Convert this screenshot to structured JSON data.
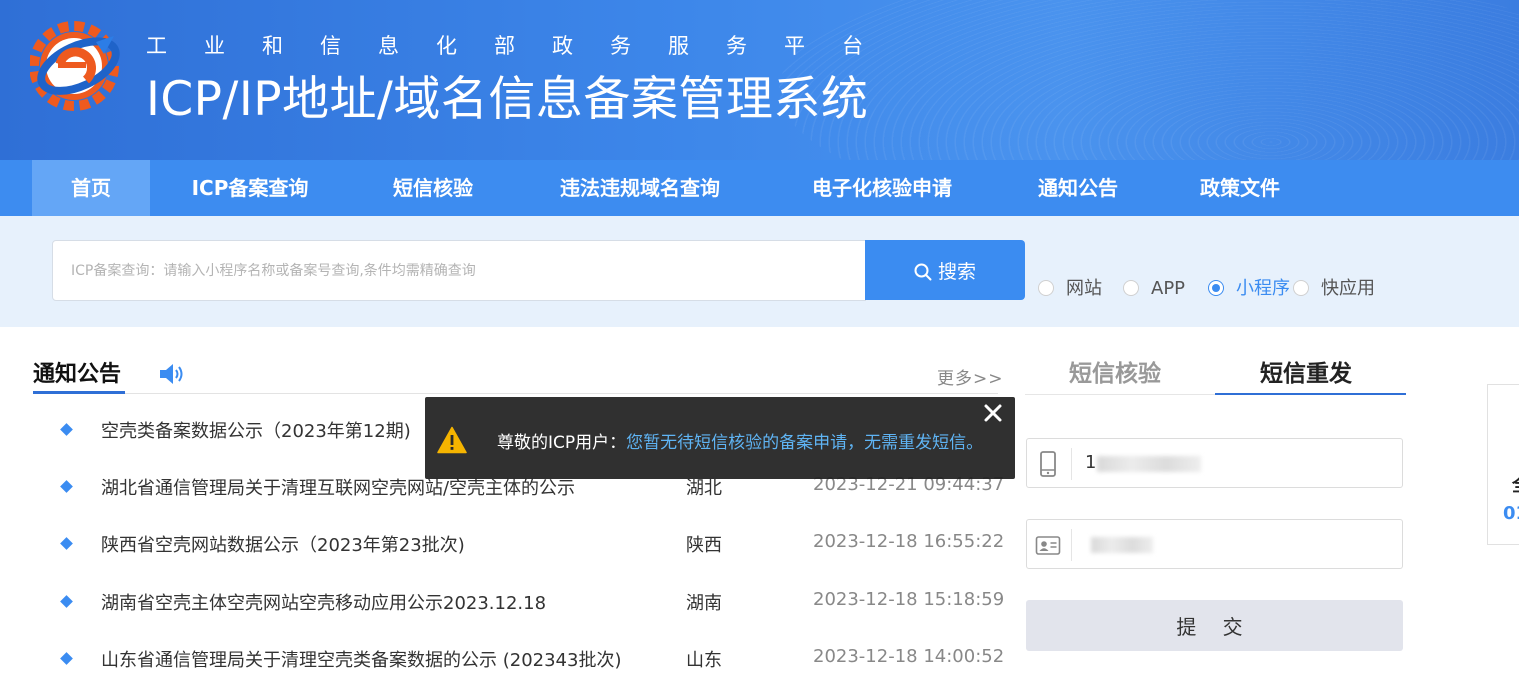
{
  "header": {
    "subtitle": "工业和信息化部政务服务平台",
    "title": "ICP/IP地址/域名信息备案管理系统"
  },
  "nav": {
    "items": [
      {
        "label": "首页",
        "active": true
      },
      {
        "label": "ICP备案查询",
        "active": false
      },
      {
        "label": "短信核验",
        "active": false
      },
      {
        "label": "违法违规域名查询",
        "active": false
      },
      {
        "label": "电子化核验申请",
        "active": false
      },
      {
        "label": "通知公告",
        "active": false
      },
      {
        "label": "政策文件",
        "active": false
      }
    ]
  },
  "search": {
    "placeholder": "ICP备案查询：请输入小程序名称或备案号查询,条件均需精确查询",
    "value": "",
    "button_label": "搜索",
    "options": [
      {
        "label": "网站",
        "checked": false
      },
      {
        "label": "APP",
        "checked": false
      },
      {
        "label": "小程序",
        "checked": true
      },
      {
        "label": "快应用",
        "checked": false
      }
    ]
  },
  "notices": {
    "heading": "通知公告",
    "more_label": "更多>>",
    "rows": [
      {
        "title": "空壳类备案数据公示（2023年第12期)",
        "province": "",
        "date": ""
      },
      {
        "title": "湖北省通信管理局关于清理互联网空壳网站/空壳主体的公示",
        "province": "湖北",
        "date": "2023-12-21 09:44:37"
      },
      {
        "title": "陕西省空壳网站数据公示（2023年第23批次)",
        "province": "陕西",
        "date": "2023-12-18 16:55:22"
      },
      {
        "title": "湖南省空壳主体空壳网站空壳移动应用公示2023.12.18",
        "province": "湖南",
        "date": "2023-12-18 15:18:59"
      },
      {
        "title": "山东省通信管理局关于清理空壳类备案数据的公示 (202343批次)",
        "province": "山东",
        "date": "2023-12-18 14:00:52"
      }
    ]
  },
  "sms_panel": {
    "tabs": [
      {
        "label": "短信核验",
        "active": false
      },
      {
        "label": "短信重发",
        "active": true
      }
    ],
    "phone_value": "1",
    "id_value": "",
    "submit_label": "提 交"
  },
  "side_card": {
    "line1": "全",
    "line2": "01"
  },
  "toast": {
    "prefix": "尊敬的ICP用户：",
    "message": "您暂无待短信核验的备案申请，无需重发短信。"
  },
  "colors": {
    "primary": "#3b8cf1",
    "nav_bg": "#3d8cf0",
    "nav_active": "#64a6f6",
    "search_band": "#e7f1fc",
    "toast_link": "#5fb4f4",
    "warning": "#f5b400",
    "logo_orange": "#ee5a1f"
  }
}
